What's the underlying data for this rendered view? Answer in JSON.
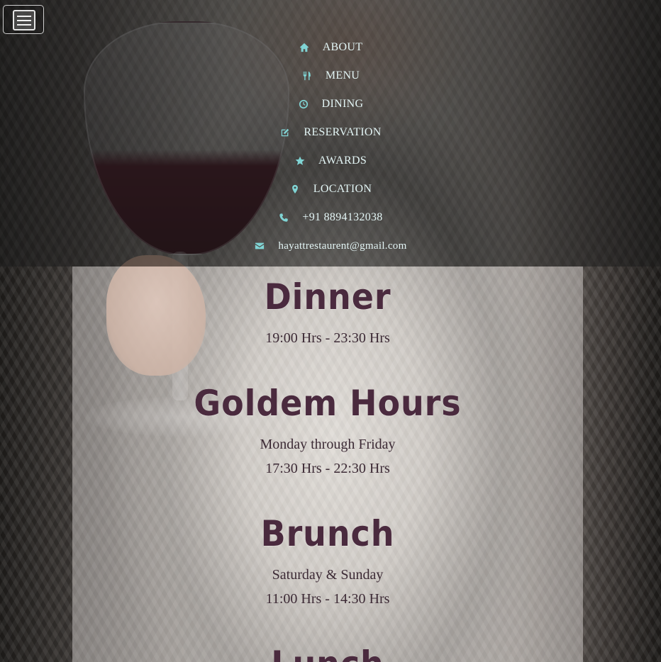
{
  "nav": {
    "toggle_label": "Toggle navigation",
    "items": [
      {
        "icon": "home-icon",
        "label": "ABOUT"
      },
      {
        "icon": "cutlery-icon",
        "label": "MENU"
      },
      {
        "icon": "clock-icon",
        "label": "DINING"
      },
      {
        "icon": "edit-icon",
        "label": "RESERVATION"
      },
      {
        "icon": "star-icon",
        "label": "AWARDS"
      },
      {
        "icon": "map-marker-icon",
        "label": "LOCATION"
      },
      {
        "icon": "phone-icon",
        "label": "+91 8894132038"
      },
      {
        "icon": "envelope-icon",
        "label": "hayattrestaurent@gmail.com"
      }
    ]
  },
  "sections": [
    {
      "title": "Dinner",
      "lines": [
        "19:00 Hrs - 23:30 Hrs"
      ]
    },
    {
      "title": "Goldem Hours",
      "lines": [
        "Monday through Friday",
        "17:30 Hrs - 22:30 Hrs"
      ]
    },
    {
      "title": "Brunch",
      "lines": [
        "Saturday & Sunday",
        "11:00 Hrs - 14:30 Hrs"
      ]
    },
    {
      "title": "Lunch",
      "lines": []
    }
  ],
  "colors": {
    "nav_text": "#e3f5f5",
    "nav_icon": "#80d4d4",
    "title": "#4a2a3e",
    "body_text": "#3c2a35"
  }
}
